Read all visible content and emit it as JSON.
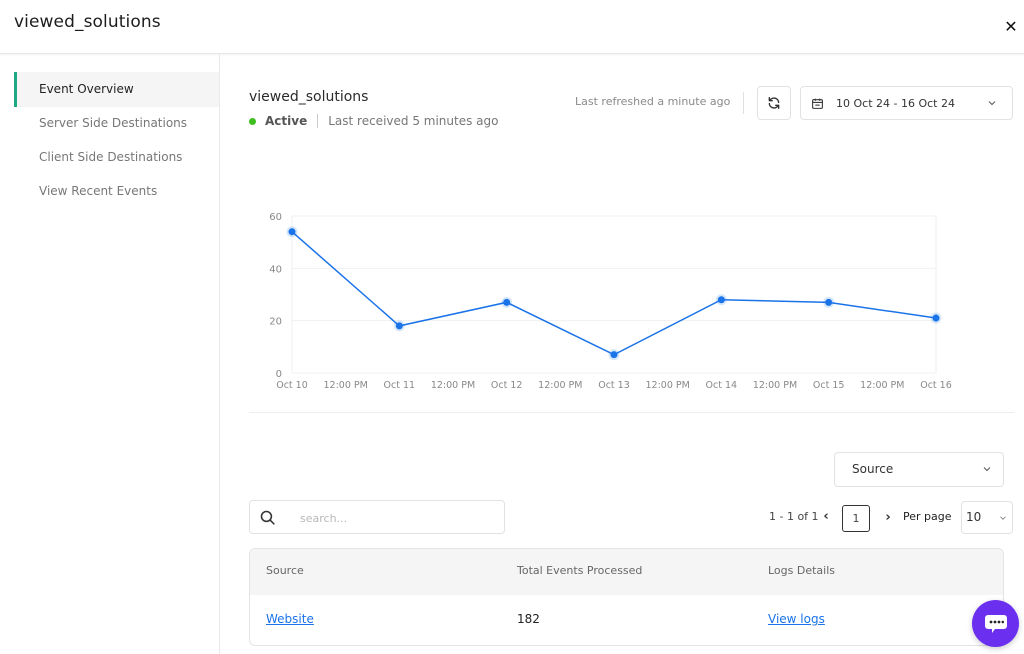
{
  "window": {
    "title": "viewed_solutions",
    "close_icon": "close-icon"
  },
  "sidebar": {
    "items": [
      {
        "label": "Event Overview",
        "active": true
      },
      {
        "label": "Server Side Destinations",
        "active": false
      },
      {
        "label": "Client Side Destinations",
        "active": false
      },
      {
        "label": "View Recent Events",
        "active": false
      }
    ]
  },
  "header": {
    "event_name": "viewed_solutions",
    "status": "Active",
    "status_color": "#3fbf1f",
    "last_received": "Last received 5 minutes ago",
    "last_refreshed": "Last refreshed a minute ago",
    "refresh_icon": "refresh-icon",
    "date_range": "10 Oct 24 - 16 Oct 24",
    "calendar_icon": "calendar-icon"
  },
  "chart_data": {
    "type": "line",
    "title": "",
    "xlabel": "",
    "ylabel": "",
    "x": [
      "Oct 10",
      "Oct 11",
      "Oct 12",
      "Oct 13",
      "Oct 14",
      "Oct 15",
      "Oct 16"
    ],
    "x_tick_labels": [
      "Oct 10",
      "12:00 PM",
      "Oct 11",
      "12:00 PM",
      "Oct 12",
      "12:00 PM",
      "Oct 13",
      "12:00 PM",
      "Oct 14",
      "12:00 PM",
      "Oct 15",
      "12:00 PM",
      "Oct 16"
    ],
    "series": [
      {
        "name": "viewed_solutions",
        "values": [
          54,
          18,
          27,
          7,
          28,
          27,
          21
        ],
        "color": "#1a73e8"
      }
    ],
    "y_ticks": [
      0,
      20,
      40,
      60
    ],
    "ylim": [
      0,
      60
    ],
    "grid": true,
    "legend": "none"
  },
  "filters": {
    "source_select": "Source",
    "search_placeholder": "search...",
    "search_value": ""
  },
  "pagination": {
    "info": "1 - 1 of 1",
    "current_page": "1",
    "prev": "‹",
    "next": "›",
    "per_page_label": "Per page",
    "per_page_value": "10"
  },
  "table": {
    "columns": [
      "Source",
      "Total Events Processed",
      "Logs Details"
    ],
    "rows": [
      {
        "source": "Website",
        "total": "182",
        "logs": "View logs"
      }
    ]
  },
  "chat": {
    "icon": "chat-icon",
    "color": "#6b2ff0"
  }
}
